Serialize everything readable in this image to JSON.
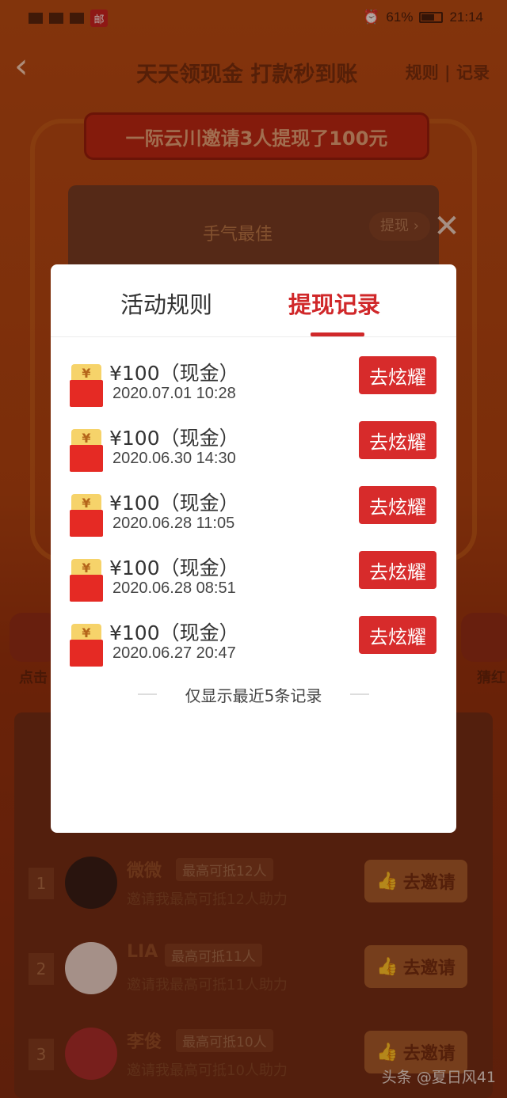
{
  "status_bar": {
    "left_badge": "邮",
    "battery": "61%",
    "time": "21:14"
  },
  "nav": {
    "back_icon": "‹",
    "title": "天天领现金 打款秒到账",
    "links": "规则 | 记录"
  },
  "banner_text": "一际云川邀请3人提现了100元",
  "card": {
    "best_label": "手气最佳",
    "withdraw_label": "提现 ›"
  },
  "close_icon": "✕",
  "side_left_label": "点击",
  "side_right_label": "猜红",
  "modal": {
    "tab_rules": "活动规则",
    "tab_records": "提现记录",
    "records": [
      {
        "amount": "¥100（现金）",
        "time": "2020.07.01 10:28",
        "button": "去炫耀"
      },
      {
        "amount": "¥100（现金）",
        "time": "2020.06.30 14:30",
        "button": "去炫耀"
      },
      {
        "amount": "¥100（现金）",
        "time": "2020.06.28 11:05",
        "button": "去炫耀"
      },
      {
        "amount": "¥100（现金）",
        "time": "2020.06.28 08:51",
        "button": "去炫耀"
      },
      {
        "amount": "¥100（现金）",
        "time": "2020.06.27 20:47",
        "button": "去炫耀"
      }
    ],
    "footnote": "仅显示最近5条记录"
  },
  "invite_list": [
    {
      "rank": "1",
      "name": "微微",
      "badge": "最高可抵12人",
      "desc": "邀请我最高可抵12人助力",
      "button": "去邀请"
    },
    {
      "rank": "2",
      "name": "LIA",
      "badge": "最高可抵11人",
      "desc": "邀请我最高可抵11人助力",
      "button": "去邀请"
    },
    {
      "rank": "3",
      "name": "李俊",
      "badge": "最高可抵10人",
      "desc": "邀请我最高可抵10人助力",
      "button": "去邀请"
    }
  ],
  "watermark": "头条 @夏日风41",
  "colors": {
    "accent": "#d0282a",
    "button": "#d72b2b",
    "background": "#a8400f"
  }
}
